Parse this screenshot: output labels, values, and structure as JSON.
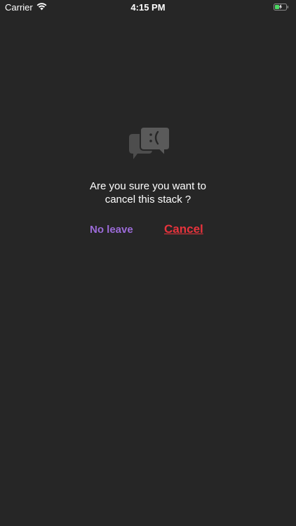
{
  "status_bar": {
    "carrier": "Carrier",
    "time": "4:15 PM",
    "battery_color": "#4cd964"
  },
  "dialog": {
    "icon": "sad-chat-bubbles-icon",
    "message_line1": "Are you sure you want to",
    "message_line2": "cancel this stack ?",
    "leave_label": "No leave",
    "cancel_label": "Cancel"
  },
  "colors": {
    "background": "#262626",
    "leave": "#9b6bd8",
    "cancel": "#e8333c"
  }
}
